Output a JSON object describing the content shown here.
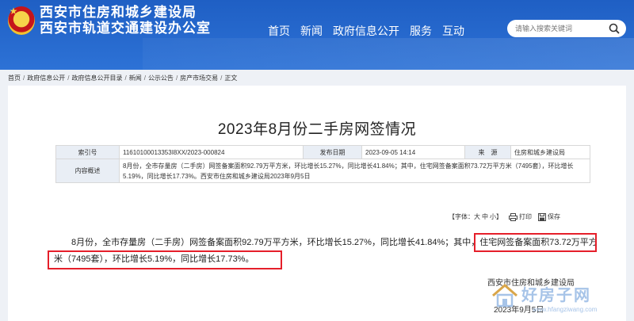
{
  "header": {
    "line1": "西安市住房和城乡建设局",
    "line2": "西安市轨道交通建设办公室",
    "nav": [
      "首页",
      "新闻",
      "政府信息公开",
      "服务",
      "互动"
    ],
    "search_placeholder": "请输入搜索关键词"
  },
  "breadcrumb": [
    "首页",
    "政府信息公开",
    "政府信息公开目录",
    "新闻",
    "公示公告",
    "房产市场交易",
    "正文"
  ],
  "article": {
    "title": "2023年8月份二手房网签情况",
    "info": {
      "index_label": "索引号",
      "index_value": "11610100013353I8XX/2023-000824",
      "date_label": "发布日期",
      "date_value": "2023-09-05 14:14",
      "source_label": "来　源",
      "source_value": "住房和城乡建设局",
      "summary_label": "内容概述",
      "summary_value": "8月份，全市存量房（二手房）网签备案面积92.79万平方米，环比增长15.27%，同比增长41.84%；其中，住宅网签备案面积73.72万平方米（7495套），环比增长5.19%，同比增长17.73%。西安市住房和城乡建设局2023年9月5日"
    },
    "tools": {
      "font_label": "【字体：",
      "font_large": "大",
      "font_medium": "中",
      "font_small": "小",
      "font_close": "】",
      "print": "打印",
      "save": "保存"
    },
    "body_part1": "8月份，全市存量房（二手房）网签备案面积92.79万平方米，环比增长15.27%，同比增长41.84%；其中，",
    "body_part2": "住宅网签备案面积73.72万平方米（7495套），环比增长5.19%，同比增长17.73%。",
    "signature": "西安市住房和城乡建设局",
    "date": "2023年9月5日"
  },
  "watermark": {
    "title": "好房子网",
    "url": "www.hfangziwang.com",
    "color": "#a7c4e8"
  },
  "colors": {
    "header_blue": "#2367cc",
    "highlight_red": "#e51f2a"
  }
}
